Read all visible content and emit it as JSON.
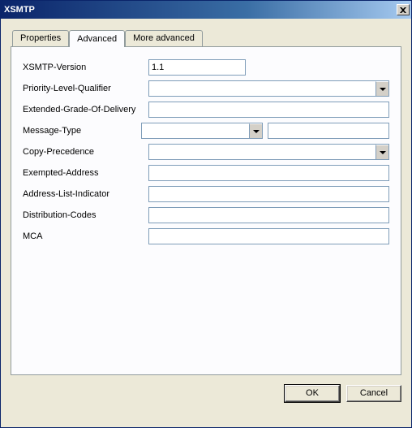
{
  "window": {
    "title": "XSMTP"
  },
  "tabs": {
    "properties": "Properties",
    "advanced": "Advanced",
    "more_advanced": "More advanced",
    "active": "advanced"
  },
  "form": {
    "xsmtp_version": {
      "label": "XSMTP-Version",
      "value": "1.1"
    },
    "priority_level_qualifier": {
      "label": "Priority-Level-Qualifier",
      "value": ""
    },
    "extended_grade_of_delivery": {
      "label": "Extended-Grade-Of-Delivery",
      "value": ""
    },
    "message_type": {
      "label": "Message-Type",
      "value": "",
      "extra": ""
    },
    "copy_precedence": {
      "label": "Copy-Precedence",
      "value": ""
    },
    "exempted_address": {
      "label": "Exempted-Address",
      "value": ""
    },
    "address_list_indicator": {
      "label": "Address-List-Indicator",
      "value": ""
    },
    "distribution_codes": {
      "label": "Distribution-Codes",
      "value": ""
    },
    "mca": {
      "label": "MCA",
      "value": ""
    }
  },
  "buttons": {
    "ok": "OK",
    "cancel": "Cancel"
  }
}
